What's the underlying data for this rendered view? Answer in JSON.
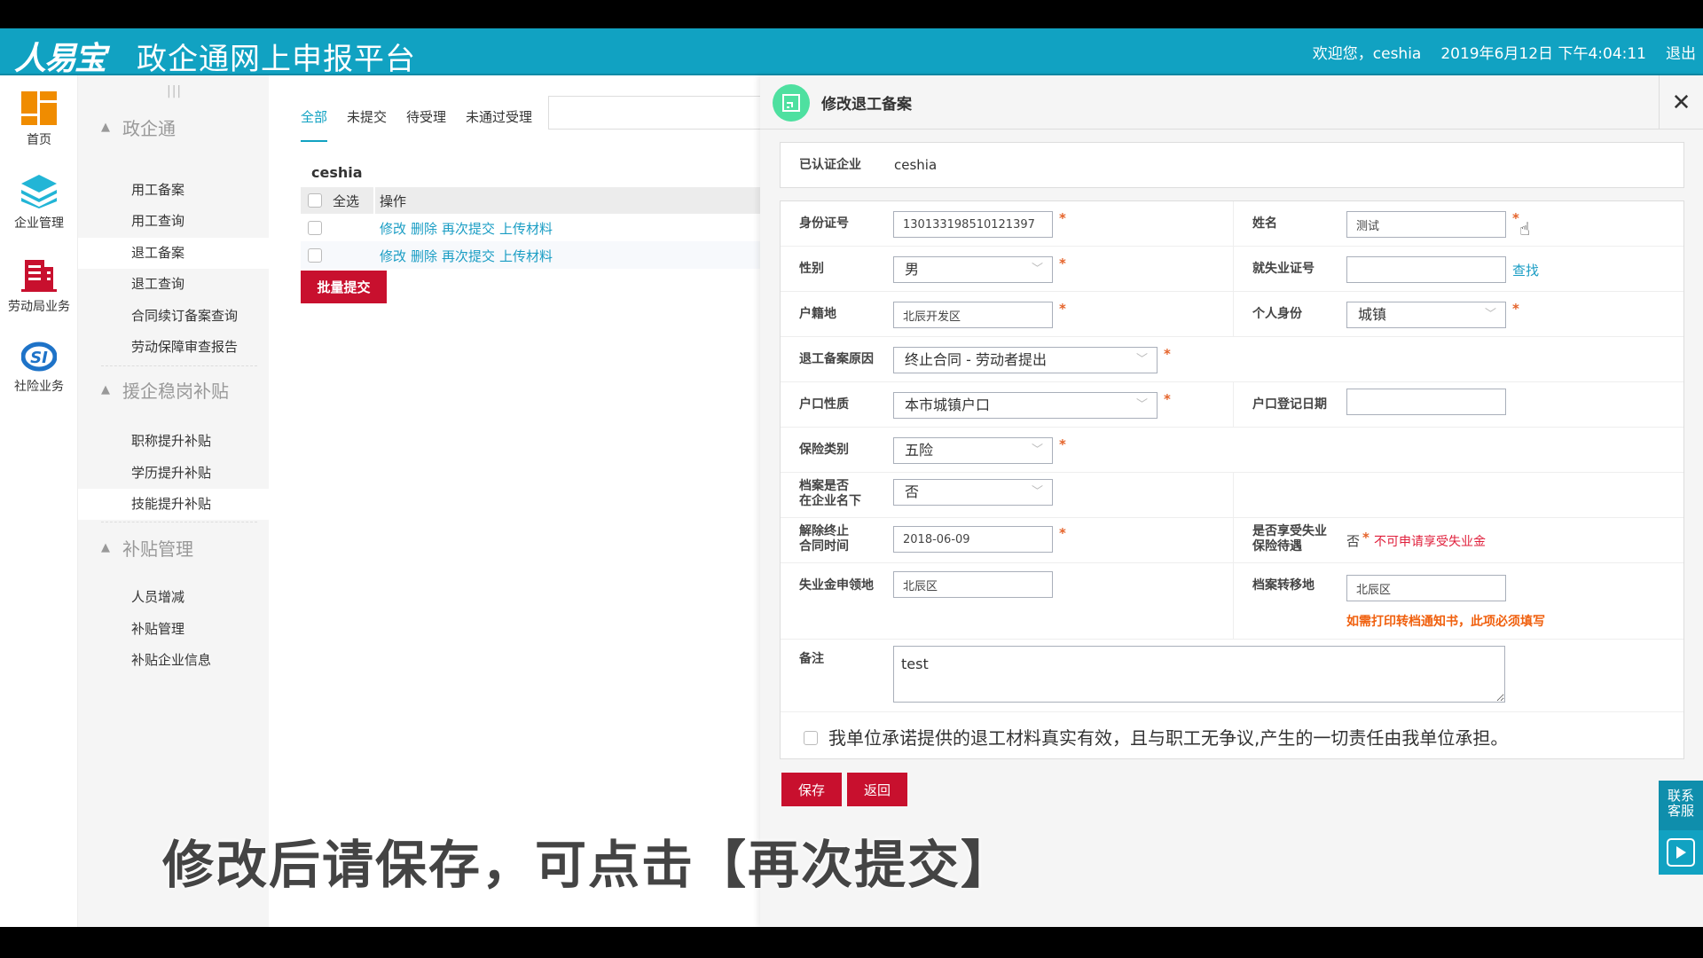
{
  "header": {
    "logo": "人易宝",
    "title": "政企通网上申报平台",
    "welcome": "欢迎您，ceshia",
    "datetime": "2019年6月12日 下午4:04:11",
    "logout": "退出"
  },
  "iconbar": [
    {
      "label": "首页",
      "icon": "home-grid-icon",
      "color": "#f08c00"
    },
    {
      "label": "企业管理",
      "icon": "layers-icon",
      "color": "#22b5d6"
    },
    {
      "label": "劳动局业务",
      "icon": "building-icon",
      "color": "#c8102e"
    },
    {
      "label": "社险业务",
      "icon": "si-logo-icon",
      "color": "#1e73c8"
    }
  ],
  "submenu": {
    "grip": "|||",
    "groups": [
      {
        "title": "政企通",
        "items": [
          "用工备案",
          "用工查询",
          "退工备案",
          "退工查询",
          "合同续订备案查询",
          "劳动保障审查报告"
        ]
      },
      {
        "title": "援企稳岗补贴",
        "items": [
          "职称提升补贴",
          "学历提升补贴",
          "技能提升补贴"
        ]
      },
      {
        "title": "补贴管理",
        "items": [
          "人员增减",
          "补贴管理",
          "补贴企业信息"
        ]
      }
    ],
    "active_item": "退工备案"
  },
  "main": {
    "tabs": [
      "全部",
      "未提交",
      "待受理",
      "未通过受理"
    ],
    "active_tab": "全部",
    "search_value": "",
    "company": "ceshia",
    "table": {
      "select_all": "全选",
      "col_ops": "操作",
      "rows": [
        {
          "ops": [
            "修改",
            "删除",
            "再次提交",
            "上传材料"
          ]
        },
        {
          "ops": [
            "修改",
            "删除",
            "再次提交",
            "上传材料"
          ]
        }
      ]
    },
    "batch_submit": "批量提交"
  },
  "panel": {
    "title": "修改退工备案",
    "close": "✕",
    "certified_label": "已认证企业",
    "certified_value": "ceshia",
    "fields": {
      "id_number": {
        "label": "身份证号",
        "value": "130133198510121397",
        "required": true
      },
      "name": {
        "label": "姓名",
        "value": "测试",
        "required": true
      },
      "gender": {
        "label": "性别",
        "value": "男",
        "required": true
      },
      "employment_cert": {
        "label": "就失业证号",
        "value": "",
        "action": "查找"
      },
      "household_place": {
        "label": "户籍地",
        "value": "北辰开发区",
        "required": true
      },
      "personal_status": {
        "label": "个人身份",
        "value": "城镇",
        "required": true
      },
      "reason": {
        "label": "退工备案原因",
        "value": "终止合同 - 劳动者提出",
        "required": true
      },
      "household_type": {
        "label": "户口性质",
        "value": "本市城镇户口",
        "required": true
      },
      "household_date": {
        "label": "户口登记日期",
        "value": ""
      },
      "insurance_type": {
        "label": "保险类别",
        "value": "五险",
        "required": true
      },
      "archive_in_company": {
        "label1": "档案是否",
        "label2": "在企业名下",
        "value": "否"
      },
      "termination_date": {
        "label1": "解除终止",
        "label2": "合同时间",
        "value": "2018-06-09",
        "required": true
      },
      "unemployment_benefit": {
        "label1": "是否享受失业",
        "label2": "保险待遇",
        "value": "否",
        "star": "*",
        "note": "不可申请享受失业金"
      },
      "benefit_place": {
        "label": "失业金申领地",
        "value": "北辰区"
      },
      "archive_transfer": {
        "label": "档案转移地",
        "value": "北辰区",
        "note": "如需打印转档通知书，此项必须填写"
      },
      "remark": {
        "label": "备注",
        "value": "test"
      }
    },
    "promise": "我单位承诺提供的退工材料真实有效，且与职工无争议,产生的一切责任由我单位承担。",
    "save": "保存",
    "back": "返回"
  },
  "service": {
    "label": "联系客服"
  },
  "caption": "修改后请保存，可点击【再次提交】",
  "colors": {
    "brand": "#11a2c2",
    "danger": "#c8102e",
    "link": "#1a9dc4",
    "required": "#e5632a"
  }
}
